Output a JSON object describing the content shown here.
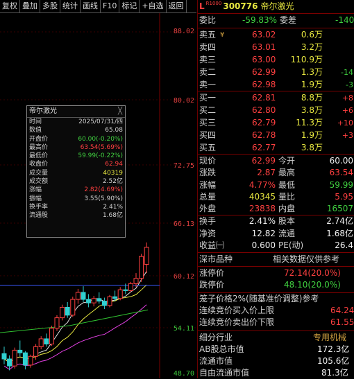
{
  "toolbar": [
    "复权",
    "叠加",
    "多股",
    "统计",
    "画线",
    "F10",
    "标记",
    "+自选",
    "返回"
  ],
  "price_axis": [
    "88.02",
    "80.02",
    "72.75",
    "66.13",
    "60.12",
    "54.11",
    "48.70"
  ],
  "tooltip": {
    "title": "帝尔激光",
    "close": "╳",
    "rows": [
      {
        "k": "时间",
        "v": "2025/07/31/四"
      },
      {
        "k": "数值",
        "v": "65.08"
      },
      {
        "k": "开盘价",
        "v": "60.00(-0.20%)"
      },
      {
        "k": "最高价",
        "v": "63.54(5.69%)"
      },
      {
        "k": "最低价",
        "v": "59.99(-0.22%)"
      },
      {
        "k": "收盘价",
        "v": "62.94"
      },
      {
        "k": "成交量",
        "v": "40319"
      },
      {
        "k": "成交额",
        "v": "2.52亿"
      },
      {
        "k": "涨幅",
        "v": "2.82(4.69%)"
      },
      {
        "k": "振幅",
        "v": "3.55(5.90%)"
      },
      {
        "k": "换手率",
        "v": "2.41%"
      },
      {
        "k": "流通股",
        "v": "1.68亿"
      }
    ]
  },
  "quote": {
    "badge": "L",
    "badge_sub": "R1000",
    "code": "300776",
    "name": "帝尔激光",
    "wb_label": "委比",
    "wb_val": "-59.83%",
    "wc_label": "委差",
    "wc_val": "-140",
    "asks": [
      {
        "l": "卖五",
        "p": "63.02",
        "v": "0.6万",
        "x": "¥"
      },
      {
        "l": "卖四",
        "p": "63.01",
        "v": "3.2万",
        "x": ""
      },
      {
        "l": "卖三",
        "p": "63.00",
        "v": "110.9万",
        "x": ""
      },
      {
        "l": "卖二",
        "p": "62.99",
        "v": "1.3万",
        "x": "-14"
      },
      {
        "l": "卖一",
        "p": "62.98",
        "v": "1.9万",
        "x": "-3"
      }
    ],
    "bids": [
      {
        "l": "买一",
        "p": "62.81",
        "v": "8.8万",
        "x": "+8"
      },
      {
        "l": "买二",
        "p": "62.80",
        "v": "3.8万",
        "x": "+6"
      },
      {
        "l": "买三",
        "p": "62.79",
        "v": "11.3万",
        "x": "+10"
      },
      {
        "l": "买四",
        "p": "62.78",
        "v": "1.9万",
        "x": "+3"
      },
      {
        "l": "买五",
        "p": "62.77",
        "v": "3.8万",
        "x": ""
      }
    ],
    "stats": [
      {
        "a": "现价",
        "av": "62.99",
        "ac": "red",
        "b": "今开",
        "bv": "60.00",
        "bc": "wht"
      },
      {
        "a": "涨跌",
        "av": "2.87",
        "ac": "red",
        "b": "最高",
        "bv": "63.54",
        "bc": "red"
      },
      {
        "a": "涨幅",
        "av": "4.77%",
        "ac": "red",
        "b": "最低",
        "bv": "59.99",
        "bc": "grn"
      },
      {
        "a": "总量",
        "av": "40345",
        "ac": "yel",
        "b": "量比",
        "bv": "5.95",
        "bc": "red"
      },
      {
        "a": "外盘",
        "av": "23838",
        "ac": "red",
        "b": "内盘",
        "bv": "16507",
        "bc": "grn"
      }
    ],
    "stats2": [
      {
        "a": "换手",
        "av": "2.41%",
        "b": "股本",
        "bv": "2.74亿"
      },
      {
        "a": "净资",
        "av": "12.82",
        "b": "流通",
        "bv": "1.68亿"
      },
      {
        "a": "收益㈠",
        "av": "0.600",
        "b": "PE(动)",
        "bv": "26.4"
      }
    ],
    "tabs": [
      "深市品种",
      "相关数据仅供参考"
    ],
    "limit_up_label": "涨停价",
    "limit_up": "72.14(20.0%)",
    "limit_down_label": "跌停价",
    "limit_down": "48.10(20.0%)",
    "cage_title": "笼子价格2%(随基准价调整)参考",
    "cage_buy_label": "连续竞价买入价上限",
    "cage_buy": "64.24",
    "cage_sell_label": "连续竞价卖出价下限",
    "cage_sell": "61.55",
    "industry_label": "细分行业",
    "industry": "专用机械",
    "ab_label": "AB股总市值",
    "ab": "172.3亿",
    "ltsz_label": "流通市值",
    "ltsz": "105.6亿",
    "zyltsz_label": "自由流通市值",
    "zyltsz": "81.3亿"
  },
  "colors": {
    "up": "#ff4040",
    "down": "#40d040",
    "axis": "#7a0000",
    "ma5": "#e0e0e0",
    "ma10": "#e8e840",
    "ma20": "#e040e0",
    "ma60": "#30c030"
  },
  "chart_data": {
    "type": "candlestick",
    "ylim": [
      48.7,
      88.02
    ],
    "candles": [
      [
        50.8,
        51.6,
        49.6,
        50.2
      ],
      [
        50.2,
        50.6,
        48.9,
        49.4
      ],
      [
        49.4,
        51.5,
        49.1,
        51.2
      ],
      [
        51.2,
        52.3,
        50.5,
        50.9
      ],
      [
        50.9,
        51.1,
        49.0,
        49.5
      ],
      [
        49.5,
        50.7,
        49.2,
        50.5
      ],
      [
        50.5,
        51.9,
        50.1,
        51.6
      ],
      [
        51.6,
        52.8,
        51.3,
        52.5
      ],
      [
        52.5,
        53.1,
        51.6,
        51.9
      ],
      [
        51.9,
        54.0,
        51.7,
        53.7
      ],
      [
        53.7,
        55.2,
        53.4,
        54.9
      ],
      [
        54.9,
        56.4,
        54.6,
        56.1
      ],
      [
        56.1,
        56.7,
        54.9,
        55.2
      ],
      [
        55.2,
        57.3,
        55.0,
        57.0
      ],
      [
        57.0,
        58.2,
        56.5,
        57.8
      ],
      [
        57.8,
        58.5,
        56.7,
        57.0
      ],
      [
        57.0,
        57.6,
        56.1,
        56.6
      ],
      [
        56.6,
        57.4,
        56.2,
        57.1
      ],
      [
        57.1,
        57.8,
        56.5,
        56.8
      ],
      [
        56.8,
        57.2,
        55.9,
        56.3
      ],
      [
        56.3,
        57.5,
        56.1,
        57.3
      ],
      [
        57.3,
        58.0,
        56.8,
        57.1
      ],
      [
        57.1,
        58.4,
        56.9,
        58.1
      ],
      [
        58.1,
        58.8,
        57.6,
        58.0
      ],
      [
        58.0,
        59.0,
        57.8,
        58.8
      ],
      [
        58.8,
        60.0,
        58.4,
        59.4
      ],
      [
        59.4,
        62.2,
        59.0,
        61.9
      ],
      [
        61.0,
        63.5,
        59.99,
        62.94
      ]
    ]
  }
}
